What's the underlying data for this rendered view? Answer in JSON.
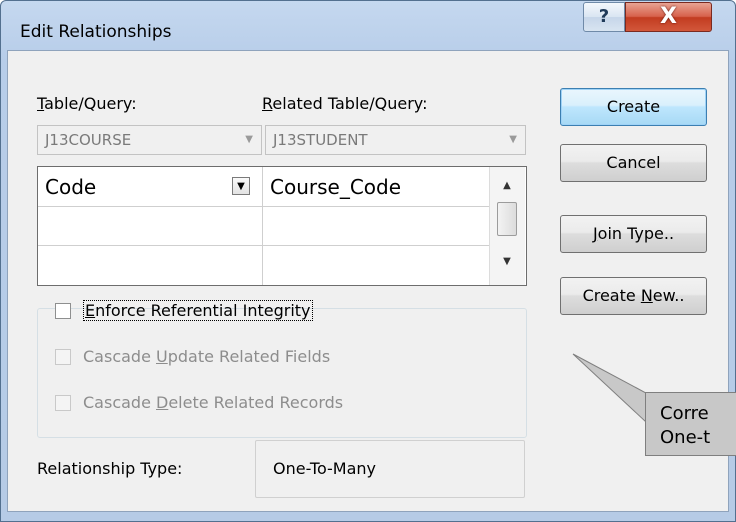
{
  "window": {
    "title": "Edit Relationships",
    "help_glyph": "?",
    "close_glyph": "X"
  },
  "table_query": {
    "label_prefix": "",
    "label_hotkey": "T",
    "label_rest": "able/Query:",
    "value": "J13COURSE"
  },
  "related_table_query": {
    "label_hotkey": "R",
    "label_rest": "elated Table/Query:",
    "value": "J13STUDENT"
  },
  "field_grid": {
    "rows": [
      {
        "left": "Code",
        "right": "Course_Code"
      },
      {
        "left": "",
        "right": ""
      },
      {
        "left": "",
        "right": ""
      }
    ]
  },
  "options": {
    "enforce": {
      "hotkey": "E",
      "rest": "nforce Referential Integrity",
      "checked": false,
      "enabled": true
    },
    "cascade_update": {
      "pre": "Cascade ",
      "hotkey": "U",
      "rest": "pdate Related Fields",
      "checked": false,
      "enabled": false
    },
    "cascade_delete": {
      "pre": "Cascade ",
      "hotkey": "D",
      "rest": "elete Related Records",
      "checked": false,
      "enabled": false
    }
  },
  "relationship_type": {
    "label": "Relationship Type:",
    "value": "One-To-Many"
  },
  "buttons": {
    "create": "Create",
    "cancel": "Cancel",
    "join_type": {
      "hotkey": "J",
      "rest": "oin Type.."
    },
    "create_new": {
      "pre": "Create ",
      "hotkey": "N",
      "rest": "ew.."
    }
  },
  "callout": {
    "line1": "Corre",
    "line2": "One-t"
  },
  "colors": {
    "default_button_border": "#3c7fb1",
    "close_button": "#c23c21",
    "callout_fill": "#c8c8c8"
  }
}
